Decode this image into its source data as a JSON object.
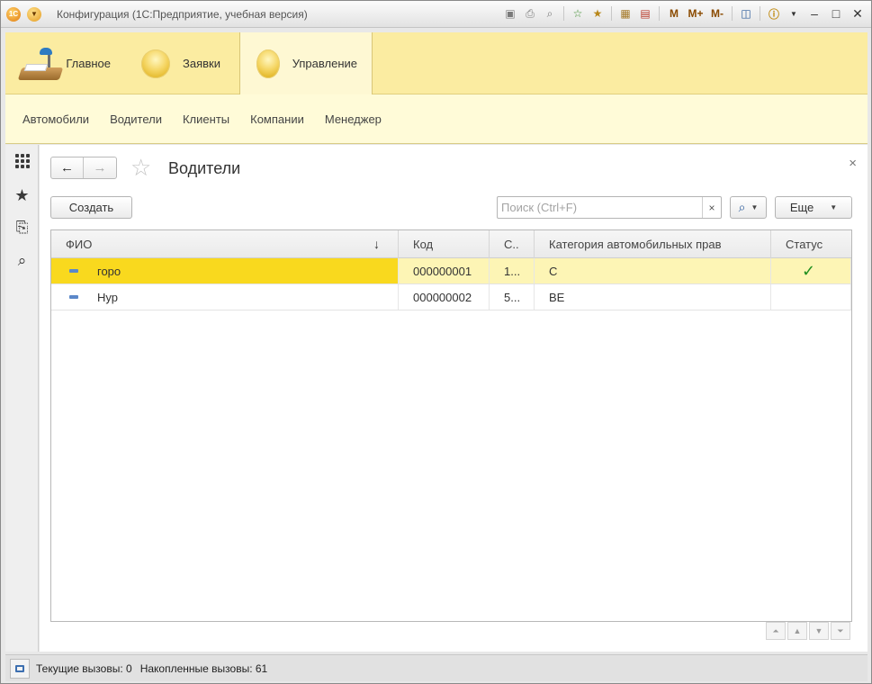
{
  "window": {
    "title": "Конфигурация  (1С:Предприятие, учебная версия)",
    "app_logo_text": "1С",
    "toolbar_icons": [
      "save-icon",
      "print-icon",
      "print-preview-icon",
      "add-favorite-icon",
      "favorites-icon",
      "calculator-icon",
      "calendar-icon"
    ],
    "memory_buttons": [
      "M",
      "M+",
      "M-"
    ],
    "info_icon": "i"
  },
  "sections": [
    {
      "label": "Главное",
      "icon": "desk-lamp-icon"
    },
    {
      "label": "Заявки",
      "icon": "orb-icon"
    },
    {
      "label": "Управление",
      "icon": "orb-icon",
      "active": true
    }
  ],
  "funcbar": {
    "items": [
      "Автомобили",
      "Водители",
      "Клиенты",
      "Компании",
      "Менеджер"
    ]
  },
  "form": {
    "title": "Водители",
    "create_label": "Создать",
    "more_label": "Еще",
    "search_placeholder": "Поиск (Ctrl+F)",
    "clear_glyph": "×",
    "close_glyph": "×"
  },
  "table": {
    "columns": [
      "ФИО",
      "Код",
      "С..",
      "Категория автомобильных прав",
      "Статус"
    ],
    "sort_glyph": "↓",
    "rows": [
      {
        "name": "горо",
        "code": "000000001",
        "c": "1...",
        "category": "C",
        "status": true,
        "selected": true
      },
      {
        "name": "Нур",
        "code": "000000002",
        "c": "5...",
        "category": "BE",
        "status": false,
        "selected": false
      }
    ]
  },
  "statusbar": {
    "current_calls": "Текущие вызовы: 0",
    "accumulated_calls": "Накопленные вызовы: 61"
  },
  "colors": {
    "section_bg": "#fbeca1",
    "funcbar_bg": "#fffbd8",
    "selected_row": "#fdf5b5",
    "selected_cell": "#f9d91e",
    "check": "#1f8f1f"
  }
}
